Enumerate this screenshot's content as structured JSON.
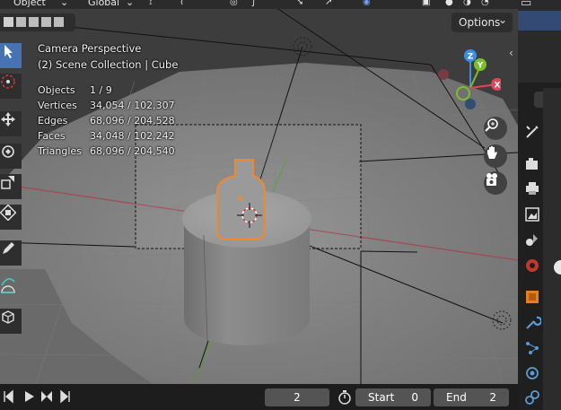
{
  "header": {
    "object_menu": "Object",
    "transform_orientation": "Global",
    "options_label": "Options"
  },
  "overlay": {
    "view_name": "Camera Perspective",
    "collection_info": "(2) Scene Collection | Cube"
  },
  "stats": [
    {
      "label": "Objects",
      "value": "1 / 9"
    },
    {
      "label": "Vertices",
      "value": "34,054 / 102,307"
    },
    {
      "label": "Edges",
      "value": "68,096 / 204,528"
    },
    {
      "label": "Faces",
      "value": "34,048 / 102,242"
    },
    {
      "label": "Triangles",
      "value": "68,096 / 204,540"
    }
  ],
  "gizmo": {
    "x": "X",
    "y": "Y",
    "z": "Z"
  },
  "timeline": {
    "current_frame": "2",
    "start_label": "Start",
    "start_value": "0",
    "end_label": "End",
    "end_value": "2"
  },
  "colors": {
    "accent": "#4772b3",
    "selection_outline": "#f0892c",
    "axis_x": "#e1455a",
    "axis_y": "#7ac02a",
    "axis_z": "#3a8fe4"
  }
}
